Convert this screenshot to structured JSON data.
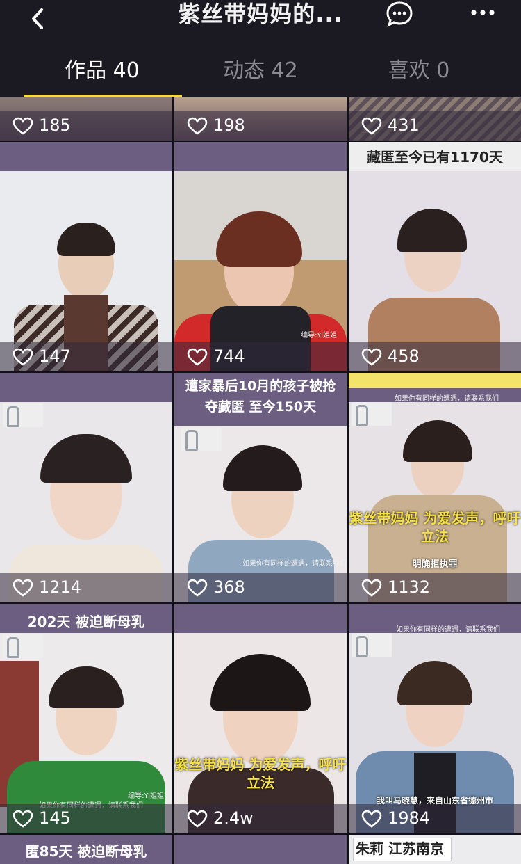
{
  "header": {
    "title": "紫丝带妈妈的...",
    "back_icon": "chevron-left-icon",
    "chat_icon": "chat-bubble-icon",
    "more_icon": "more-icon"
  },
  "tabs": [
    {
      "label": "作品 40",
      "active": true
    },
    {
      "label": "动态 42",
      "active": false
    },
    {
      "label": "喜欢 0",
      "active": false
    }
  ],
  "colors": {
    "accent": "#f6d84a",
    "background": "#17161e",
    "cell_band": "#6a5a7e"
  },
  "videos": [
    {
      "likes": "185"
    },
    {
      "likes": "198"
    },
    {
      "likes": "431"
    },
    {
      "likes": "147"
    },
    {
      "likes": "744",
      "credit": "编导:Yi姐姐"
    },
    {
      "likes": "458",
      "caption": "藏匿至今已有1170天"
    },
    {
      "likes": "1214"
    },
    {
      "likes": "368",
      "caption": "遭家暴后10月的孩子被抢夺藏匿 至今150天",
      "note": "如果你有同样的遭遇，请联系我们"
    },
    {
      "likes": "1132",
      "note": "如果你有同样的遭遇，请联系我们",
      "caption": "紫丝带妈妈 为爱发声，呼吁立法",
      "sub": "明确拒执罪"
    },
    {
      "likes": "145",
      "caption": "202天  被迫断母乳",
      "credit": "编导:Yi姐姐",
      "note": "如果你有同样的遭遇，请联系我们"
    },
    {
      "likes": "2.4w",
      "caption": "紫丝带妈妈 为爱发声，呼吁立法"
    },
    {
      "likes": "1984",
      "note": "如果你有同样的遭遇，请联系我们",
      "sub": "我叫马晓慧，来自山东省德州市"
    },
    {
      "caption": "匿85天  被迫断母乳"
    },
    {},
    {
      "caption": "朱莉  江苏南京"
    }
  ]
}
